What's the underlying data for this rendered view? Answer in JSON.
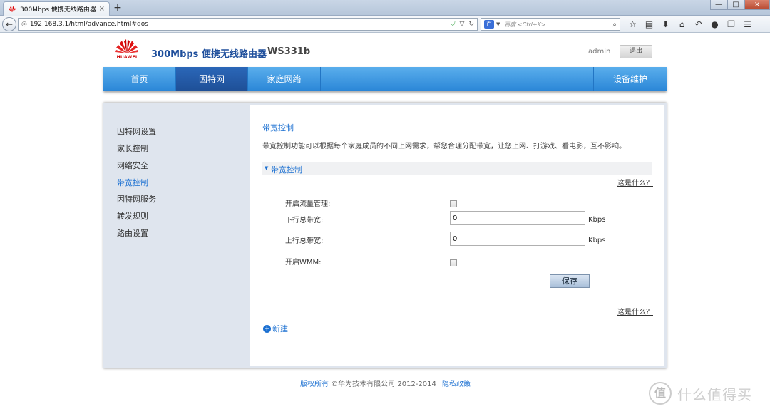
{
  "browser": {
    "tab_title": "300Mbps 便携无线路由器",
    "tab_close": "×",
    "new_tab": "+",
    "url": "192.168.3.1/html/advance.html#qos",
    "search_placeholder": "百度 <Ctrl+K>",
    "search_engine": "百",
    "toolbar_icons": [
      "star-icon",
      "bookmarks-icon",
      "download-icon",
      "home-icon",
      "sync-icon",
      "chat-icon",
      "copy-icon",
      "menu-icon"
    ],
    "window_buttons": {
      "minimize": "—",
      "maximize": "□",
      "close": "×"
    }
  },
  "header": {
    "logo_text": "HUAWEI",
    "product_name": "300Mbps 便携无线路由器",
    "model": "WS331b",
    "username": "admin",
    "logout_label": "退出",
    "brand_color": "#c00000"
  },
  "nav": {
    "items": [
      {
        "label": "首页",
        "active": false
      },
      {
        "label": "因特网",
        "active": true
      },
      {
        "label": "家庭网络",
        "active": false
      }
    ],
    "right_item": "设备维护"
  },
  "sidebar": {
    "items": [
      {
        "label": "因特网设置",
        "active": false
      },
      {
        "label": "家长控制",
        "active": false
      },
      {
        "label": "网络安全",
        "active": false
      },
      {
        "label": "带宽控制",
        "active": true
      },
      {
        "label": "因特网服务",
        "active": false
      },
      {
        "label": "转发规则",
        "active": false
      },
      {
        "label": "路由设置",
        "active": false
      }
    ]
  },
  "content": {
    "title": "带宽控制",
    "description": "带宽控制功能可以根据每个家庭成员的不同上网需求，帮您合理分配带宽，让您上网、打游戏、看电影，互不影响。",
    "section_title": "带宽控制",
    "help_link": "这是什么？",
    "help_link_bottom": "这是什么？",
    "fields": {
      "enable_traffic_label": "开启流量管理:",
      "enable_traffic_checked": false,
      "downlink_label": "下行总带宽:",
      "downlink_value": "0",
      "downlink_unit": "Kbps",
      "uplink_label": "上行总带宽:",
      "uplink_value": "0",
      "uplink_unit": "Kbps",
      "wmm_label": "开启WMM:",
      "wmm_checked": false
    },
    "save_label": "保存",
    "add_new_label": "新建"
  },
  "footer": {
    "copyright_link": "版权所有",
    "copyright_text": " ©华为技术有限公司 2012-2014",
    "privacy": "隐私政策"
  },
  "watermark": {
    "symbol": "值",
    "text": "什么值得买"
  },
  "colors": {
    "accent": "#1a6fd1",
    "nav_bg": "#3a96e0",
    "nav_active": "#1e4f97",
    "panel_bg": "#dfe5ee"
  }
}
